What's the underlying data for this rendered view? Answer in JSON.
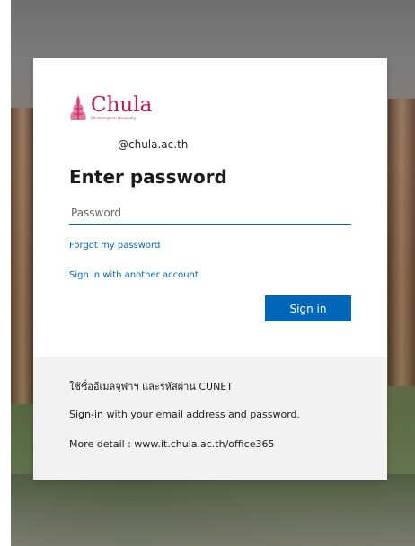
{
  "brand": {
    "logo_text": "Chula",
    "logo_subtitle": "Chulalongkorn University",
    "color": "#c2185b"
  },
  "login": {
    "identity": "@chula.ac.th",
    "title": "Enter password",
    "password_placeholder": "Password",
    "forgot_link": "Forgot my password",
    "other_account_link": "Sign in with another account",
    "signin_button": "Sign in",
    "accent_color": "#0067b8"
  },
  "info": {
    "line1": "ใช้ชื่ออีเมลจุฬาฯ และรหัสผ่าน CUNET",
    "line2": "Sign-in with your email address and password.",
    "line3": "More detail : www.it.chula.ac.th/office365"
  }
}
